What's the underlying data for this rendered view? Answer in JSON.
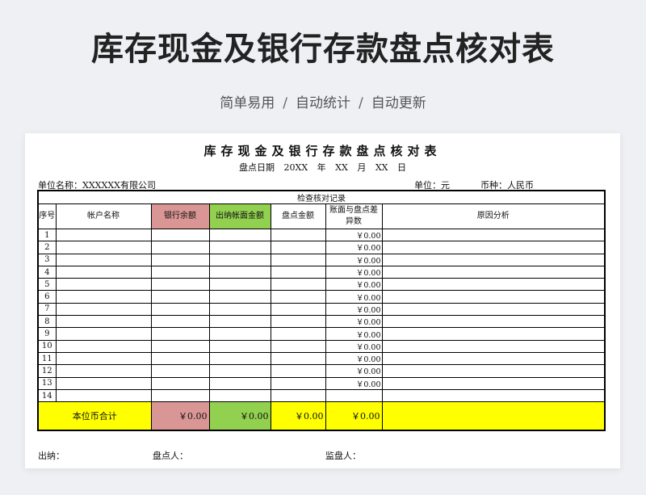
{
  "banner": {
    "title": "库存现金及银行存款盘点核对表",
    "tags": [
      "简单易用",
      "自动统计",
      "自动更新"
    ],
    "separator": "/"
  },
  "document": {
    "title": "库存现金及银行存款盘点核对表",
    "date_label": "盘点日期",
    "date_year": "20XX",
    "year_label": "年",
    "date_month": "XX",
    "month_label": "月",
    "date_day": "XX",
    "day_label": "日",
    "unit_name": "单位名称：XXXXXX有限公司",
    "unit": "单位：元",
    "currency": "币种：人民币"
  },
  "table": {
    "group_header": "检查核对记录",
    "headers": {
      "no": "序号",
      "account": "帐户名称",
      "bank_balance": "银行余额",
      "ledger_amount": "出纳帐面金额",
      "count_amount": "盘点金额",
      "difference": "账面与盘点差异数",
      "reason": "原因分析"
    },
    "rows": [
      {
        "no": "1",
        "difference": "￥0.00"
      },
      {
        "no": "2",
        "difference": "￥0.00"
      },
      {
        "no": "3",
        "difference": "￥0.00"
      },
      {
        "no": "4",
        "difference": "￥0.00"
      },
      {
        "no": "5",
        "difference": "￥0.00"
      },
      {
        "no": "6",
        "difference": "￥0.00"
      },
      {
        "no": "7",
        "difference": "￥0.00"
      },
      {
        "no": "8",
        "difference": "￥0.00"
      },
      {
        "no": "9",
        "difference": "￥0.00"
      },
      {
        "no": "10",
        "difference": "￥0.00"
      },
      {
        "no": "11",
        "difference": "￥0.00"
      },
      {
        "no": "12",
        "difference": "￥0.00"
      },
      {
        "no": "13",
        "difference": "￥0.00"
      },
      {
        "no": "14",
        "difference": ""
      }
    ],
    "total": {
      "label": "本位币合计",
      "bank_balance": "￥0.00",
      "ledger_amount": "￥0.00",
      "count_amount": "￥0.00",
      "difference": "￥0.00"
    }
  },
  "footer": {
    "cashier": "出纳：",
    "counter": "盘点人：",
    "supervisor": "监盘人："
  },
  "colors": {
    "bank_fill": "#d99694",
    "ledger_fill": "#92d050",
    "total_fill": "#ffff00"
  }
}
